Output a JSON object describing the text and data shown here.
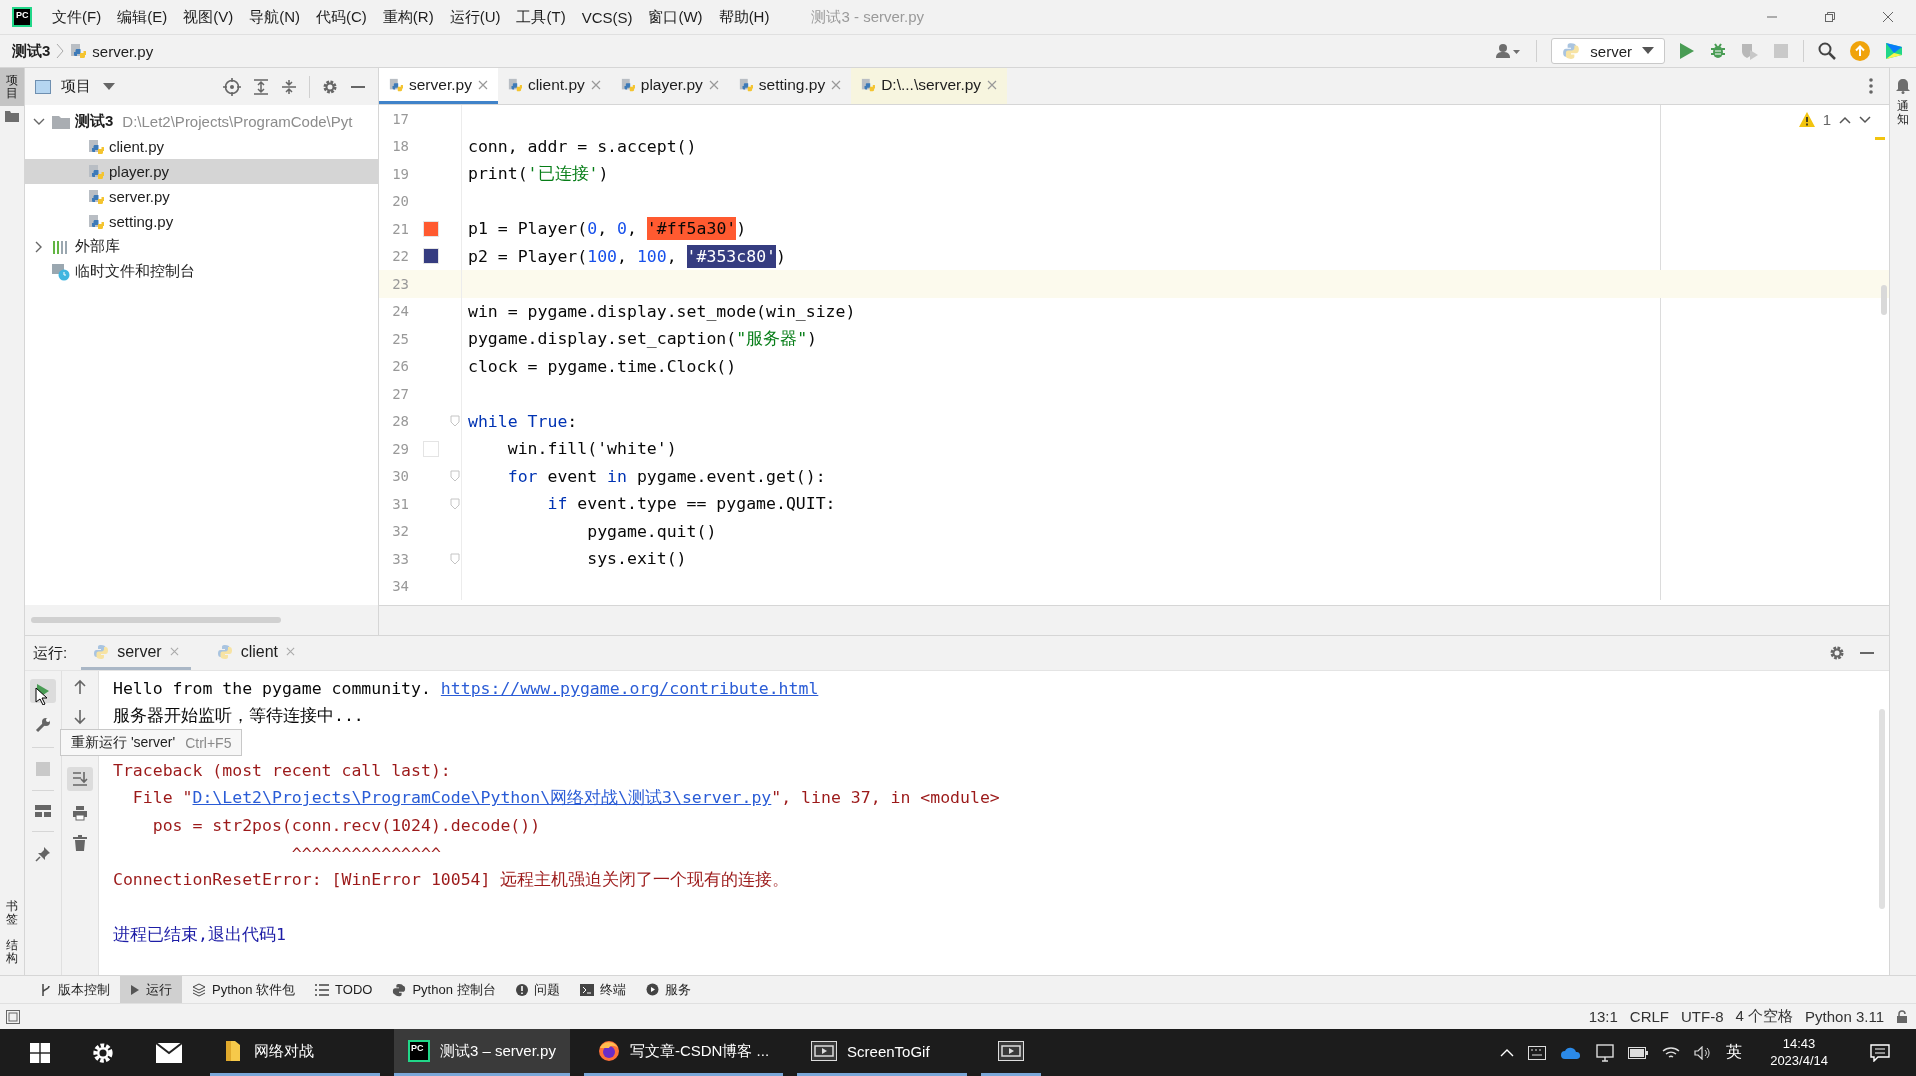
{
  "window": {
    "title": "测试3 - server.py",
    "app_logo": "PC"
  },
  "menu": [
    "文件(F)",
    "编辑(E)",
    "视图(V)",
    "导航(N)",
    "代码(C)",
    "重构(R)",
    "运行(U)",
    "工具(T)",
    "VCS(S)",
    "窗口(W)",
    "帮助(H)"
  ],
  "breadcrumb": [
    "测试3",
    "server.py"
  ],
  "run_config": "server",
  "left_strip": {
    "top": [
      {
        "label": "项目",
        "selected": true
      }
    ],
    "bottom": [
      {
        "label": "书签",
        "selected": false
      },
      {
        "label": "结构",
        "selected": false
      }
    ]
  },
  "right_strip": [
    {
      "label": "通知"
    }
  ],
  "project_panel": {
    "title": "项目",
    "tree": [
      {
        "label": "测试3",
        "path": "D:\\Let2\\Projects\\ProgramCode\\Pyt",
        "kind": "folder",
        "expanded": true,
        "selected": false,
        "children": [
          {
            "label": "client.py",
            "kind": "python",
            "selected": false
          },
          {
            "label": "player.py",
            "kind": "python",
            "selected": true
          },
          {
            "label": "server.py",
            "kind": "python",
            "selected": false
          },
          {
            "label": "setting.py",
            "kind": "python",
            "selected": false
          }
        ]
      },
      {
        "label": "外部库",
        "kind": "library",
        "expanded": false,
        "selected": false
      },
      {
        "label": "临时文件和控制台",
        "kind": "scratch",
        "selected": false
      }
    ]
  },
  "editor": {
    "tabs": [
      {
        "label": "server.py",
        "selected": true,
        "external": false
      },
      {
        "label": "client.py",
        "selected": false,
        "external": false
      },
      {
        "label": "player.py",
        "selected": false,
        "external": false
      },
      {
        "label": "setting.py",
        "selected": false,
        "external": false
      },
      {
        "label": "D:\\...\\server.py",
        "selected": false,
        "external": true
      }
    ],
    "warnings": "1",
    "lines": [
      {
        "number": "17"
      },
      {
        "number": "18",
        "tokens": [
          {
            "text": "conn, addr = s.accept()",
            "kind": "plain"
          }
        ]
      },
      {
        "number": "19",
        "tokens": [
          {
            "text": "print(",
            "kind": "plain"
          },
          {
            "text": "'已连接'",
            "kind": "str"
          },
          {
            "text": ")",
            "kind": "plain"
          }
        ]
      },
      {
        "number": "20"
      },
      {
        "number": "21",
        "color": "#ff5a30",
        "tokens": [
          {
            "text": "p1 = Player(",
            "kind": "plain"
          },
          {
            "text": "0",
            "kind": "num"
          },
          {
            "text": ", ",
            "kind": "plain"
          },
          {
            "text": "0",
            "kind": "num"
          },
          {
            "text": ", ",
            "kind": "plain"
          },
          {
            "text": "'#ff5a30'",
            "kind": "swatch",
            "color": "#ff5a30"
          },
          {
            "text": ")",
            "kind": "plain"
          }
        ]
      },
      {
        "number": "22",
        "color": "#353c80",
        "tokens": [
          {
            "text": "p2 = Player(",
            "kind": "plain"
          },
          {
            "text": "100",
            "kind": "num"
          },
          {
            "text": ", ",
            "kind": "plain"
          },
          {
            "text": "100",
            "kind": "num"
          },
          {
            "text": ", ",
            "kind": "plain"
          },
          {
            "text": "'#353c80'",
            "kind": "swatch",
            "color": "#353c80"
          },
          {
            "text": ")",
            "kind": "plain"
          }
        ]
      },
      {
        "number": "23",
        "current": true
      },
      {
        "number": "24",
        "tokens": [
          {
            "text": "win = pygame.display.set_mode(win_size)",
            "kind": "plain"
          }
        ]
      },
      {
        "number": "25",
        "tokens": [
          {
            "text": "pygame.display.set_caption(",
            "kind": "plain"
          },
          {
            "text": "\"服务器\"",
            "kind": "str"
          },
          {
            "text": ")",
            "kind": "plain"
          }
        ]
      },
      {
        "number": "26",
        "tokens": [
          {
            "text": "clock = pygame.time.Clock()",
            "kind": "plain"
          }
        ]
      },
      {
        "number": "27"
      },
      {
        "number": "28",
        "fold": true,
        "tokens": [
          {
            "text": "while",
            "kind": "kw"
          },
          {
            "text": " True",
            "kind": "kw"
          },
          {
            "text": ":",
            "kind": "plain"
          }
        ]
      },
      {
        "number": "29",
        "color": "#ffffff",
        "tokens": [
          {
            "text": "    win.fill('white')",
            "kind": "plain"
          }
        ]
      },
      {
        "number": "30",
        "fold": true,
        "tokens": [
          {
            "text": "    for",
            "kind": "kw"
          },
          {
            "text": " event ",
            "kind": "plain"
          },
          {
            "text": "in",
            "kind": "kw"
          },
          {
            "text": " pygame.event.get():",
            "kind": "plain"
          }
        ]
      },
      {
        "number": "31",
        "fold": true,
        "tokens": [
          {
            "text": "        if",
            "kind": "kw"
          },
          {
            "text": " event.type == pygame.QUIT:",
            "kind": "plain"
          }
        ]
      },
      {
        "number": "32",
        "tokens": [
          {
            "text": "            pygame.quit()",
            "kind": "plain"
          }
        ]
      },
      {
        "number": "33",
        "fold": true,
        "tokens": [
          {
            "text": "            sys.exit()",
            "kind": "plain"
          }
        ]
      },
      {
        "number": "34"
      }
    ]
  },
  "run": {
    "title": "运行:",
    "tabs": [
      {
        "label": "server",
        "selected": true
      },
      {
        "label": "client",
        "selected": false
      }
    ],
    "tooltip": {
      "text": "重新运行 'server'",
      "shortcut": "Ctrl+F5"
    },
    "console": [
      {
        "segments": [
          {
            "text": "Hello from the pygame community. ",
            "kind": "out"
          },
          {
            "text": "https://www.pygame.org/contribute.html",
            "kind": "link"
          }
        ]
      },
      {
        "segments": [
          {
            "text": "服务器开始监听，等待连接中...",
            "kind": "out"
          }
        ]
      },
      {
        "gap_before": true,
        "segments": [
          {
            "text": "Traceback (most recent call last):",
            "kind": "err"
          }
        ]
      },
      {
        "segments": [
          {
            "text": "  File \"",
            "kind": "err"
          },
          {
            "text": "D:\\Let2\\Projects\\ProgramCode\\Python\\网络对战\\测试3\\server.py",
            "kind": "link"
          },
          {
            "text": "\", line 37, in <module>",
            "kind": "err"
          }
        ]
      },
      {
        "segments": [
          {
            "text": "    pos = str2pos(conn.recv(1024).decode())",
            "kind": "err"
          }
        ]
      },
      {
        "segments": [
          {
            "text": "                  ^^^^^^^^^^^^^^^",
            "kind": "err"
          }
        ]
      },
      {
        "segments": [
          {
            "text": "ConnectionResetError: [WinError 10054] 远程主机强迫关闭了一个现有的连接。",
            "kind": "err"
          }
        ]
      },
      {
        "gap_before": true,
        "segments": [
          {
            "text": "进程已结束,退出代码1",
            "kind": "exit"
          }
        ]
      }
    ]
  },
  "tool_tabs": [
    {
      "label": "版本控制",
      "kind": "vcs",
      "selected": false
    },
    {
      "label": "运行",
      "kind": "run",
      "selected": true
    },
    {
      "label": "Python 软件包",
      "kind": "packages",
      "selected": false
    },
    {
      "label": "TODO",
      "kind": "todo",
      "selected": false
    },
    {
      "label": "Python 控制台",
      "kind": "console",
      "selected": false
    },
    {
      "label": "问题",
      "kind": "problems",
      "selected": false
    },
    {
      "label": "终端",
      "kind": "terminal",
      "selected": false
    },
    {
      "label": "服务",
      "kind": "services",
      "selected": false
    }
  ],
  "status_bar": [
    "13:1",
    "CRLF",
    "UTF-8",
    "4 个空格",
    "Python 3.11"
  ],
  "taskbar": {
    "apps": [
      {
        "label": "网络对战",
        "kind": "folder",
        "active": false
      },
      {
        "label": "测试3 – server.py",
        "kind": "pycharm",
        "icon_text": "PC",
        "active": true
      },
      {
        "label": "写文章-CSDN博客 ...",
        "kind": "firefox",
        "active": false
      },
      {
        "label": "ScreenToGif",
        "kind": "recorder",
        "active": false
      },
      {
        "kind": "recorder",
        "active": false
      }
    ],
    "ime": "英",
    "time": "14:43",
    "date": "2023/4/14"
  }
}
